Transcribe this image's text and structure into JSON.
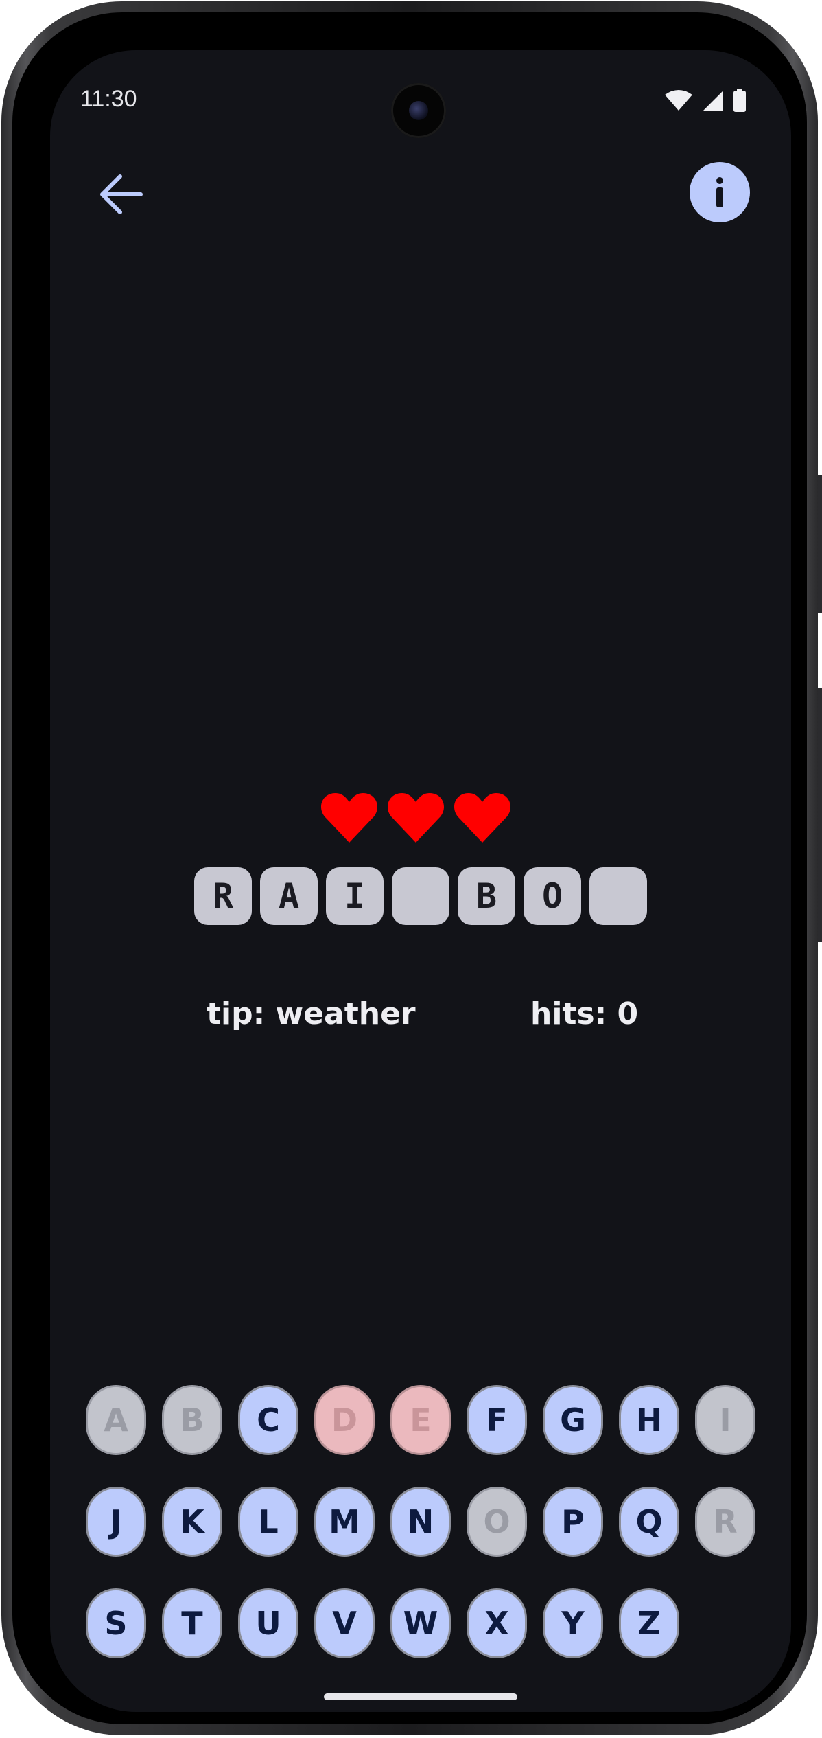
{
  "status_bar": {
    "time": "11:30"
  },
  "toolbar": {
    "back_icon": "arrow-back-icon",
    "info_icon": "info-icon",
    "accent_color": "#bccbfc"
  },
  "lives": {
    "count": 3,
    "icon": "heart-icon",
    "color": "#ff0000"
  },
  "word": {
    "tiles": [
      "R",
      "A",
      "I",
      "",
      "B",
      "O",
      ""
    ]
  },
  "tip": {
    "text": "tip: weather"
  },
  "hits": {
    "text": "hits: 0"
  },
  "keyboard": {
    "rows": [
      [
        {
          "letter": "A",
          "state": "used"
        },
        {
          "letter": "B",
          "state": "used"
        },
        {
          "letter": "C",
          "state": "available"
        },
        {
          "letter": "D",
          "state": "wrong"
        },
        {
          "letter": "E",
          "state": "wrong"
        },
        {
          "letter": "F",
          "state": "available"
        },
        {
          "letter": "G",
          "state": "available"
        },
        {
          "letter": "H",
          "state": "available"
        },
        {
          "letter": "I",
          "state": "used"
        }
      ],
      [
        {
          "letter": "J",
          "state": "available"
        },
        {
          "letter": "K",
          "state": "available"
        },
        {
          "letter": "L",
          "state": "available"
        },
        {
          "letter": "M",
          "state": "available"
        },
        {
          "letter": "N",
          "state": "available"
        },
        {
          "letter": "O",
          "state": "used"
        },
        {
          "letter": "P",
          "state": "available"
        },
        {
          "letter": "Q",
          "state": "available"
        },
        {
          "letter": "R",
          "state": "used"
        }
      ],
      [
        {
          "letter": "S",
          "state": "available"
        },
        {
          "letter": "T",
          "state": "available"
        },
        {
          "letter": "U",
          "state": "available"
        },
        {
          "letter": "V",
          "state": "available"
        },
        {
          "letter": "W",
          "state": "available"
        },
        {
          "letter": "X",
          "state": "available"
        },
        {
          "letter": "Y",
          "state": "available"
        },
        {
          "letter": "Z",
          "state": "available"
        }
      ]
    ]
  }
}
